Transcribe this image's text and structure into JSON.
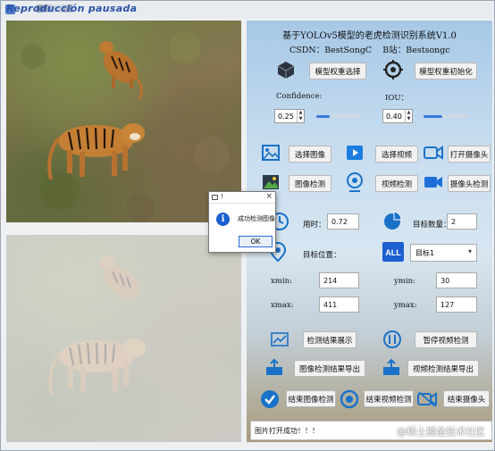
{
  "window": {
    "title": "Reproducción pausada"
  },
  "app": {
    "title": "基于YOLOv5模型的老虎检测识别系统V1.0",
    "credits_csdn": "CSDN：BestSongC",
    "credits_bili": "B站：Bestsongc"
  },
  "model": {
    "select_label": "模型权重选择",
    "init_label": "模型权重初始化"
  },
  "thresholds": {
    "confidence_label": "Confidence:",
    "confidence_value": "0.25",
    "confidence_fill": 0.3,
    "iou_label": "IOU：",
    "iou_value": "0.40",
    "iou_fill": 0.42
  },
  "sources": {
    "select_image": "选择图像",
    "select_video": "选择视频",
    "open_camera": "打开摄像头",
    "image_detect": "图像检测",
    "video_detect": "视频检测",
    "camera_detect": "摄像头检测"
  },
  "results": {
    "time_label": "用时：",
    "time_value": "0.72",
    "count_label": "目标数量：",
    "count_value": "2",
    "position_label": "目标位置：",
    "target_select": "目标1",
    "xmin_label": "xmin:",
    "xmin_value": "214",
    "ymin_label": "ymin:",
    "ymin_value": "30",
    "xmax_label": "xmax:",
    "xmax_value": "411",
    "ymax_label": "ymax:",
    "ymax_value": "127"
  },
  "actions": {
    "show_results": "检测结果展示",
    "pause_video": "暂停视频检测",
    "export_image": "图像检测结果导出",
    "export_video": "视频检测结果导出",
    "end_image": "结束图像检测",
    "end_video": "结束视频检测",
    "end_camera": "结束摄像头"
  },
  "status": {
    "message": "图片打开成功！！！"
  },
  "watermark": "@稀土掘金技术社区",
  "dialog": {
    "title": "!",
    "message": "成功检测图像",
    "ok": "OK",
    "close": "×"
  }
}
